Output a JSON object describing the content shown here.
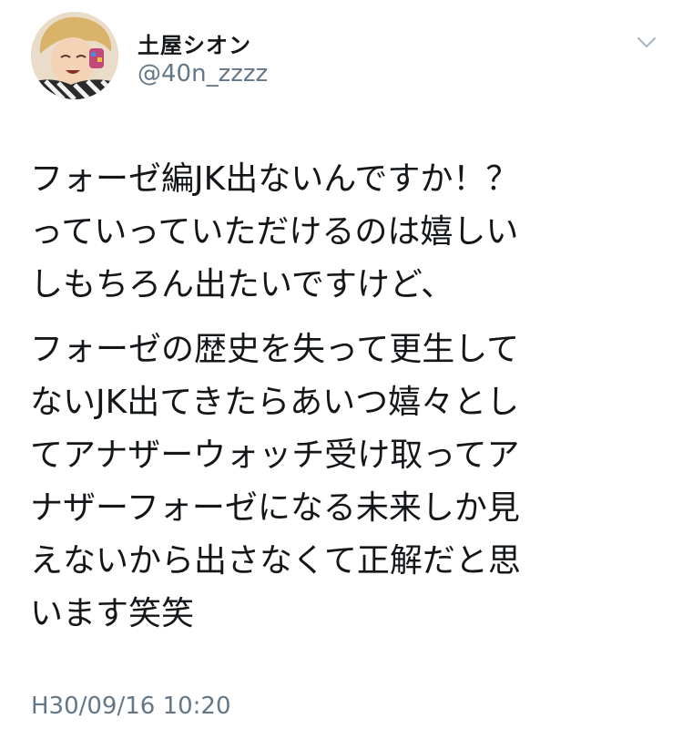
{
  "author": {
    "display_name": "土屋シオン",
    "handle": "@40n_zzzz"
  },
  "menu": {
    "icon": "chevron-down-icon"
  },
  "tweet": {
    "paragraphs": [
      {
        "lines": [
          "フォーゼ編JK出ないんですか！？",
          "っていっていただけるのは嬉しい",
          "しもちろん出たいですけど、"
        ]
      },
      {
        "lines": [
          "フォーゼの歴史を失って更生して",
          "ないJK出てきたらあいつ嬉々とし",
          "てアナザーウォッチ受け取ってア",
          "ナザーフォーゼになる未来しか見",
          "えないから出さなくて正解だと思",
          "います笑笑"
        ]
      }
    ],
    "timestamp": "H30/09/16 10:20"
  },
  "colors": {
    "text": "#14171a",
    "secondary_text": "#657786",
    "chevron": "#aab8c2"
  }
}
